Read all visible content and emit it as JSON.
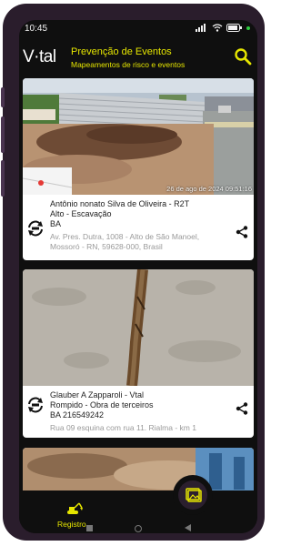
{
  "status_bar": {
    "time": "10:45"
  },
  "app": {
    "logo": "V·tal",
    "title": "Prevenção de Eventos",
    "subtitle": "Mapeamentos de risco e eventos"
  },
  "cards": [
    {
      "timestamp": "26 de ago de 2024 09:51:16",
      "name": "Antônio nonato Silva de Oliveira  - R2T",
      "event": "Alto - Escavação",
      "state": "BA",
      "address_line1": "Av. Pres. Dutra, 1008 - Alto de São Manoel,",
      "address_line2": "Mossoró - RN, 59628-000, Brasil"
    },
    {
      "name": "Glauber A Zapparoli - Vtal",
      "event": "Rompido - Obra de terceiros",
      "state": "BA 216549242",
      "address_line1": "Rua 09 esquina com rua 11. Rialma  - km 1"
    }
  ],
  "bottom_nav": {
    "register_label": "Registro"
  },
  "colors": {
    "accent": "#e6e600",
    "background": "#0f0f0f",
    "phone_frame": "#2a1d2c"
  }
}
